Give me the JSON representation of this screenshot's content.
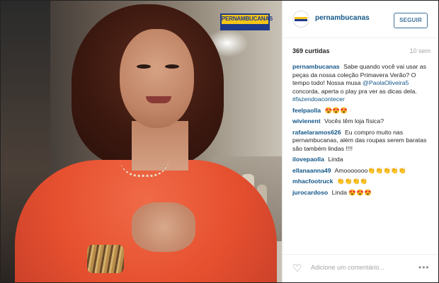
{
  "media": {
    "brand_logo_text": "PERNAMBUCANAS",
    "brand_colors": {
      "blue": "#1e3a8a",
      "yellow": "#f5c518"
    }
  },
  "header": {
    "username": "pernambucanas",
    "follow_label": "SEGUIR"
  },
  "stats": {
    "likes": "369 curtidas",
    "time_ago": "10 sem"
  },
  "caption": {
    "user": "pernambucanas",
    "text_part1": "Sabe quando você vai usar as peças da nossa coleção Primavera Verão? O tempo todo! Nossa musa",
    "mention": "@PaolaOliveira5",
    "text_part2": "concorda, aperta o play pra ver as dicas dela.",
    "hashtag": "#fazendoacontecer"
  },
  "comments": [
    {
      "user": "feelpaolla",
      "text": "😍😍😍"
    },
    {
      "user": "wivienent",
      "text": "Vocês têm loja física?"
    },
    {
      "user": "rafaelaramos626",
      "text": "Eu compro muito nas pernambucanas, além das roupas serem baratas são também lindas !!!!"
    },
    {
      "user": "ilovepaolla",
      "text": "Linda"
    },
    {
      "user": "ellanaanna49",
      "text": "Amooooooo👏👏👏👏👏"
    },
    {
      "user": "mhacfootruck",
      "text": "👏👏👏👏"
    },
    {
      "user": "jurocardoso",
      "text": "Linda 😍😍😍"
    }
  ],
  "footer": {
    "add_comment_placeholder": "Adicione um comentário...",
    "more_label": "•••"
  }
}
